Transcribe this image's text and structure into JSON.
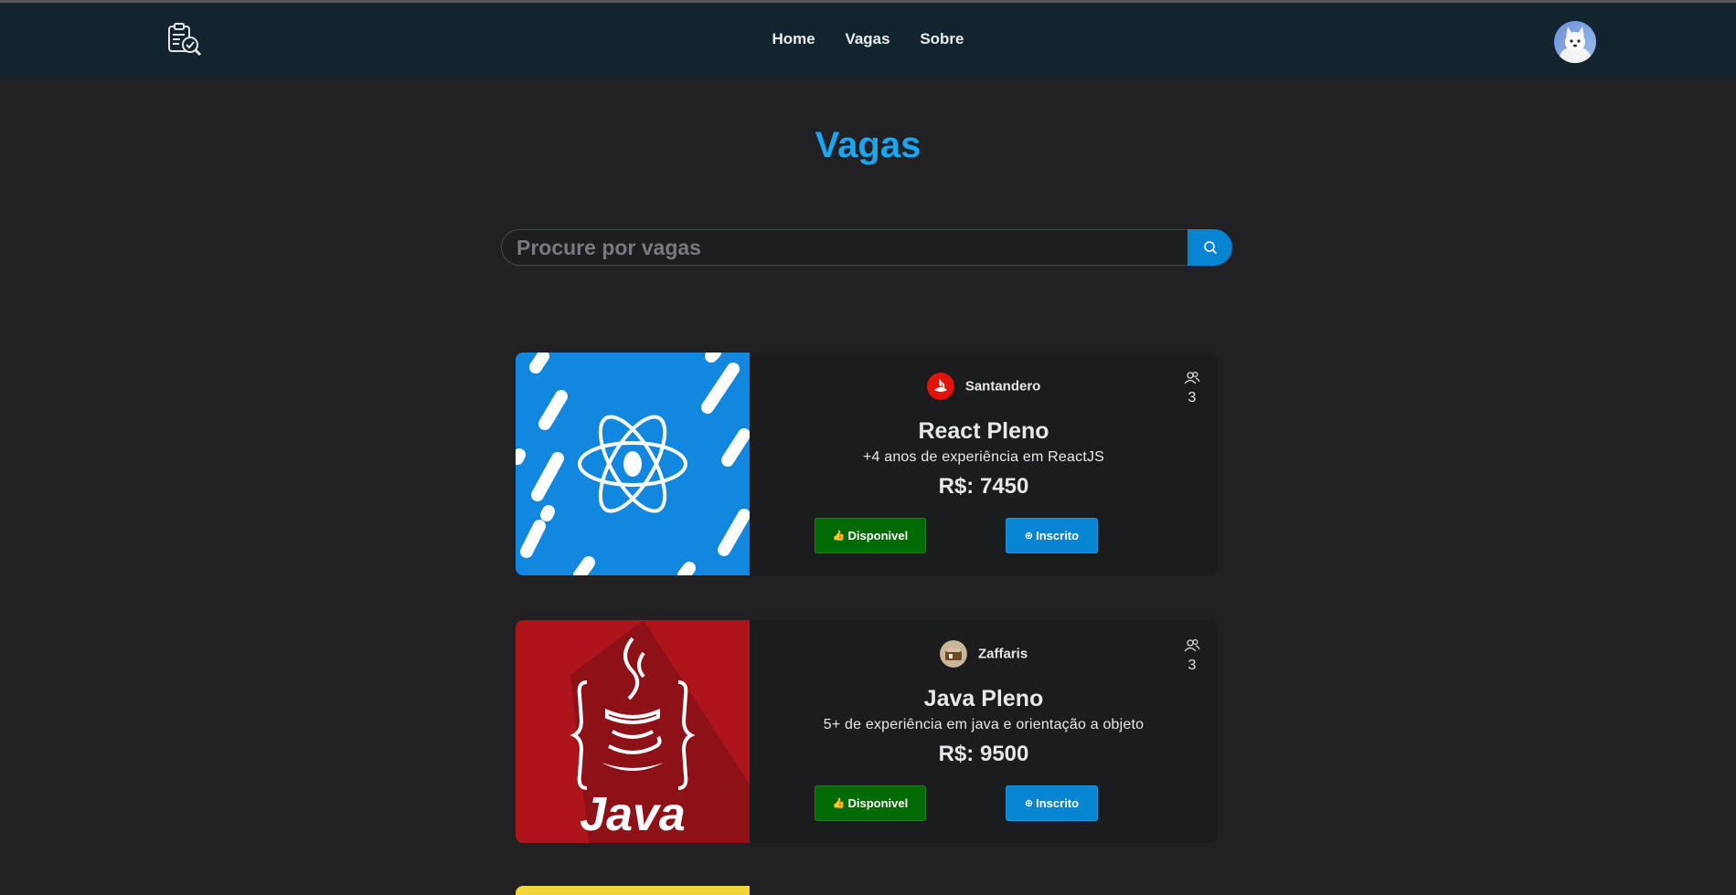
{
  "nav": {
    "links": [
      "Home",
      "Vagas",
      "Sobre"
    ]
  },
  "page": {
    "title": "Vagas"
  },
  "search": {
    "placeholder": "Procure por vagas"
  },
  "jobs": [
    {
      "company": "Santandero",
      "applicants": "3",
      "role": "React Pleno",
      "description": "+4 anos de experiência em ReactJS",
      "salary": "R$: 7450",
      "status_label": "Disponivel",
      "action_label": "Inscrito",
      "image": "react-logo"
    },
    {
      "company": "Zaffaris",
      "applicants": "3",
      "role": "Java Pleno",
      "description": "5+ de experiência em java e orientação a objeto",
      "salary": "R$: 9500",
      "status_label": "Disponivel",
      "action_label": "Inscrito",
      "image": "java-logo"
    }
  ],
  "colors": {
    "accent": "#1ba6f2",
    "navbar": "#12242e",
    "available": "#036b05",
    "subscribed": "#0785d3"
  }
}
